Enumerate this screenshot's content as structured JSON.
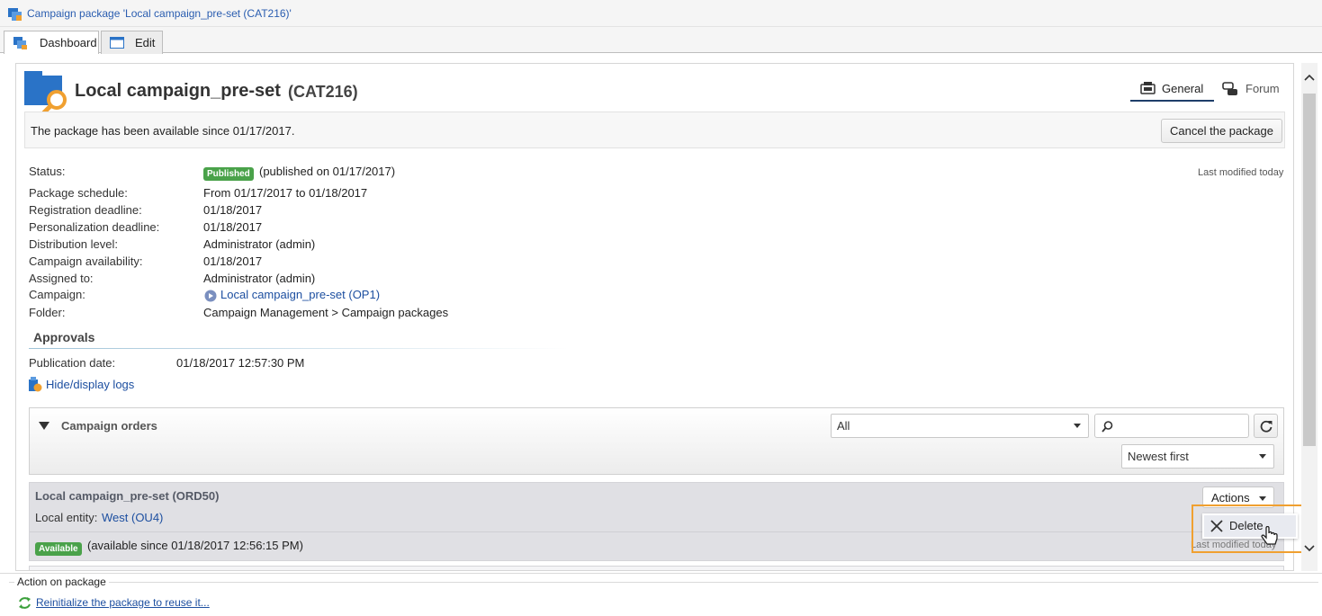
{
  "window": {
    "title": "Campaign package 'Local campaign_pre-set (CAT216)'"
  },
  "tabs": [
    {
      "label": "Dashboard"
    },
    {
      "label": "Edit"
    }
  ],
  "header": {
    "title": "Local campaign_pre-set",
    "code": "(CAT216)",
    "view_tabs": {
      "general": "General",
      "forum": "Forum"
    }
  },
  "info_bar": {
    "message": "The package has been available since 01/17/2017.",
    "cancel_button": "Cancel the package"
  },
  "details": {
    "status_label": "Status:",
    "status_badge": "Published",
    "status_text": "(published on 01/17/2017)",
    "last_modified": "Last modified today",
    "rows": [
      {
        "label": "Package schedule:",
        "value": "From 01/17/2017 to 01/18/2017"
      },
      {
        "label": "Registration deadline:",
        "value": "01/18/2017"
      },
      {
        "label": "Personalization deadline:",
        "value": "01/18/2017"
      },
      {
        "label": "Distribution level:",
        "value": "Administrator (admin)"
      },
      {
        "label": "Campaign availability:",
        "value": "01/18/2017"
      },
      {
        "label": "Assigned to:",
        "value": "Administrator (admin)"
      },
      {
        "label": "Campaign:",
        "value": "Local campaign_pre-set (OP1)"
      },
      {
        "label": "Folder:",
        "value": "Campaign Management > Campaign packages"
      }
    ]
  },
  "approvals": {
    "heading": "Approvals",
    "publication_label": "Publication date:",
    "publication_value": "01/18/2017 12:57:30 PM",
    "logs_link": "Hide/display logs"
  },
  "orders": {
    "heading": "Campaign orders",
    "filter_value": "All",
    "search_value": "",
    "sort_value": "Newest first",
    "item": {
      "title": "Local campaign_pre-set (ORD50)",
      "entity_label": "Local entity:",
      "entity_value": "West (OU4)",
      "badge": "Available",
      "available_text": "(available since 01/18/2017 12:56:15 PM)",
      "actions_button": "Actions",
      "menu_delete": "Delete",
      "hidden_text": "Last modified today"
    }
  },
  "footer": {
    "heading": "Action on package",
    "link": "Reinitialize the package to reuse it..."
  },
  "colors": {
    "accent": "#1d4fa0",
    "badge_green": "#4aa24a",
    "highlight": "#f0a030"
  }
}
